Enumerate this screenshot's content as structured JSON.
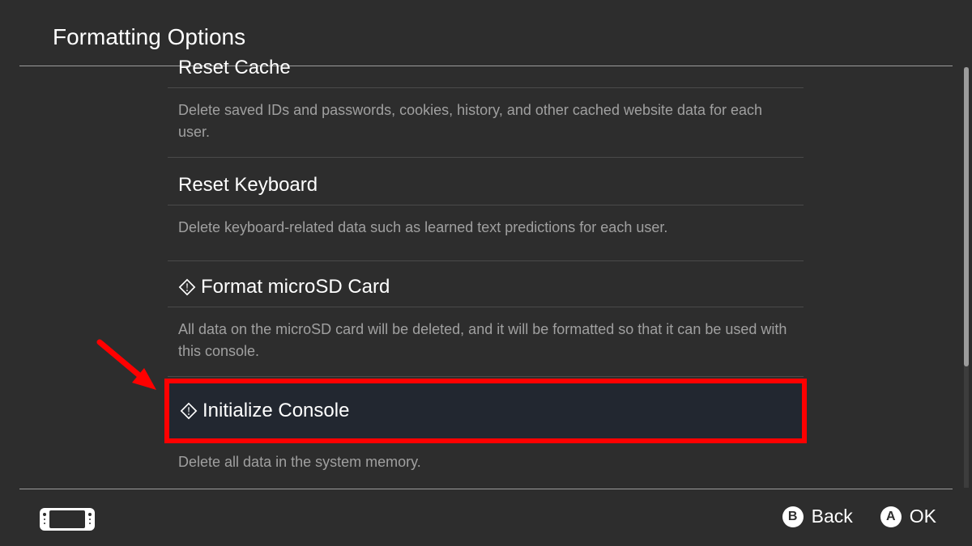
{
  "header": {
    "title": "Formatting Options"
  },
  "items": [
    {
      "title": "Reset Cache",
      "desc": "Delete saved IDs and passwords, cookies, history, and other cached website data for each user.",
      "icon": false
    },
    {
      "title": "Reset Keyboard",
      "desc": "Delete keyboard-related data such as learned text predictions for each user.",
      "icon": false
    },
    {
      "title": "Format microSD Card",
      "desc": "All data on the microSD card will be deleted, and it will be formatted so that it can be used with this console.",
      "icon": true
    },
    {
      "title": "Initialize Console",
      "desc": "Delete all data in the system memory.",
      "icon": true
    }
  ],
  "footer": {
    "back_button": {
      "glyph": "B",
      "label": "Back"
    },
    "ok_button": {
      "glyph": "A",
      "label": "OK"
    }
  },
  "annotation": {
    "highlight_index": 3,
    "color": "#ff0000"
  }
}
